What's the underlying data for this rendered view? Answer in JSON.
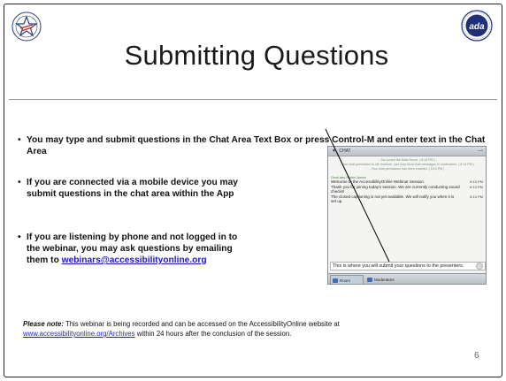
{
  "slide": {
    "title": "Submitting Questions",
    "bullets": [
      "You may type and submit questions in the Chat Area Text Box or press Control-M and enter text in the Chat Area",
      "If you are connected via a mobile device you may submit questions in the chat area within the App",
      "If you are listening by phone and not logged in to the webinar, you may ask questions by emailing them to"
    ],
    "email": "webinars@accessibilityonline.org",
    "note": {
      "lead": "Please note:",
      "text_before": " This webinar is being recorded and can be accessed on the AccessibilityOnline website at ",
      "link": "www.accessibilityonline.org/Archives",
      "text_after": " within 24 hours after the conclusion of the session."
    },
    "page_number": "6"
  },
  "chat": {
    "header": "CHAT",
    "system_lines": [
      "- You joined the Main Room. ( 8:14 PM ) -",
      "- Your chat permission is off; however, you may send chat messages to moderators. ( 8:14 PM ) -",
      "- Your chat permission has been enabled. ( 8:14 PM ) -"
    ],
    "author": "OneLabs Robin Jones",
    "messages": [
      {
        "text": "Welcome to the AccessibilityOnline Webinar Session.",
        "time": "8:15 PM"
      },
      {
        "text": "Thank you for joining today's session. We are currently conducting sound checks!",
        "time": "8:15 PM"
      },
      {
        "text": "The closed captioning is not yet available. We will notify you when it is set up.",
        "time": "8:15 PM"
      }
    ],
    "input_text": "This is where you will submit your questions to the presenters.",
    "tabs": [
      "Room",
      "Moderators"
    ]
  }
}
